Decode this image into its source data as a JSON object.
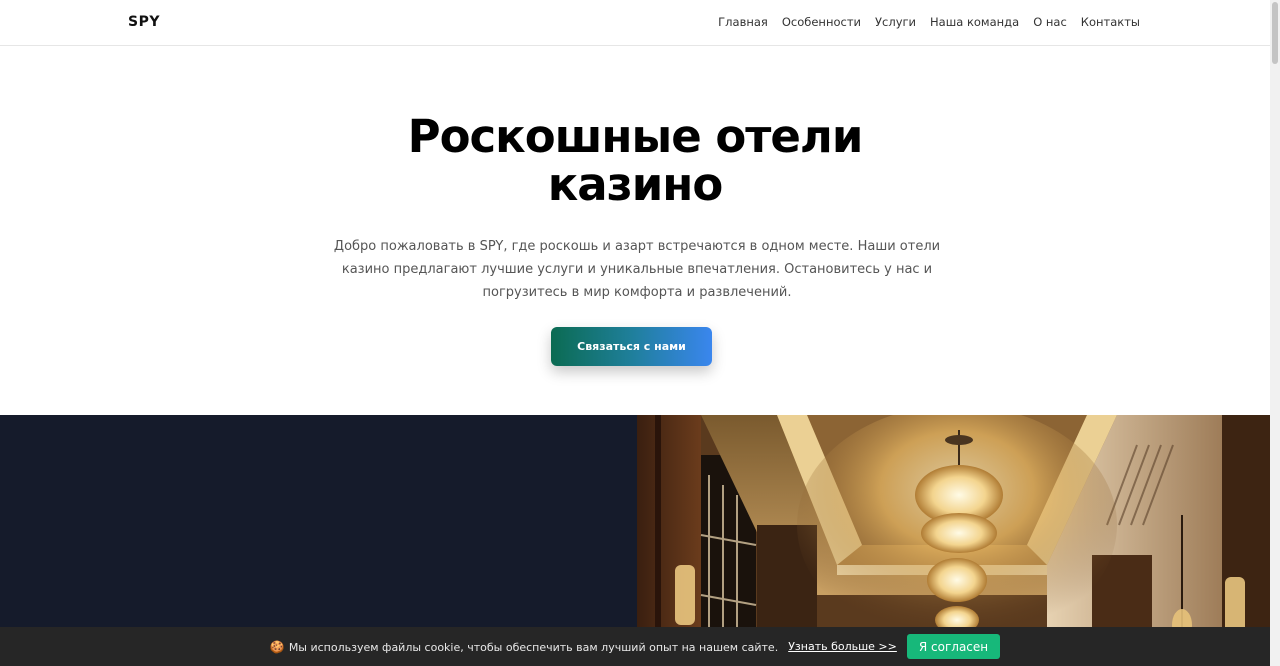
{
  "nav": {
    "brand": "SPY",
    "links": [
      "Главная",
      "Особенности",
      "Услуги",
      "Наша команда",
      "О нас",
      "Контакты"
    ]
  },
  "hero": {
    "title_line1": "Роскошные отели",
    "title_line2": "казино",
    "text": "Добро пожаловать в SPY, где роскошь и азарт встречаются в одном месте. Наши отели казино предлагают лучшие услуги и уникальные впечатления. Остановитесь у нас и погрузитесь в мир комфорта и развлечений.",
    "cta_label": "Связаться с нами"
  },
  "cookie": {
    "icon": "🍪",
    "text": "Мы используем файлы cookie, чтобы обеспечить вам лучший опыт на нашем сайте.",
    "link": "Узнать больше >>",
    "accept": "Я согласен"
  },
  "colors": {
    "dark_bg": "#141a2a",
    "cookie_bg": "#262626",
    "accept_green": "#17b87a",
    "cta_gradient_start": "#0b6b52",
    "cta_gradient_end": "#3a86ee"
  },
  "image": {
    "icon": "hotel-lobby-chandelier-image"
  }
}
